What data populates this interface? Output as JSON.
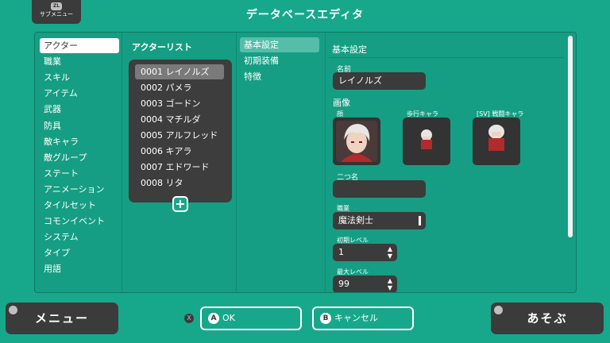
{
  "submenu": {
    "badge": "ZL",
    "label": "サブメニュー"
  },
  "title": "データベースエディタ",
  "categories": [
    "アクター",
    "職業",
    "スキル",
    "アイテム",
    "武器",
    "防具",
    "敵キャラ",
    "敵グループ",
    "ステート",
    "アニメーション",
    "タイルセット",
    "コモンイベント",
    "システム",
    "タイプ",
    "用語"
  ],
  "actor_list": {
    "header": "アクターリスト",
    "items": [
      "0001 レイノルズ",
      "0002 パメラ",
      "0003 ゴードン",
      "0004 マチルダ",
      "0005 アルフレッド",
      "0006 キアラ",
      "0007 エドワード",
      "0008 リタ"
    ],
    "add_icon": "+"
  },
  "tabs": [
    "基本設定",
    "初期装備",
    "特徴"
  ],
  "detail": {
    "header": "基本設定",
    "name_label": "名前",
    "name_value": "レイノルズ",
    "image_label": "画像",
    "face_label": "顔",
    "walk_label": "歩行キャラ",
    "battle_label": "[SV] 戦闘キャラ",
    "nickname_label": "二つ名",
    "nickname_value": "",
    "class_label": "職業",
    "class_value": "魔法剣士",
    "init_level_label": "初期レベル",
    "init_level_value": "1",
    "max_level_label": "最大レベル",
    "max_level_value": "99"
  },
  "footer": {
    "menu_label": "メニュー",
    "ok_key": "A",
    "ok_label": "OK",
    "cancel_key": "B",
    "cancel_label": "キャンセル",
    "play_label": "あそぶ",
    "x_key": "X"
  },
  "colors": {
    "background": "#17a88c",
    "panel": "#159e83",
    "dark": "#3b3b3b",
    "hair": "#d9d9d9",
    "coat": "#b02b2b"
  }
}
